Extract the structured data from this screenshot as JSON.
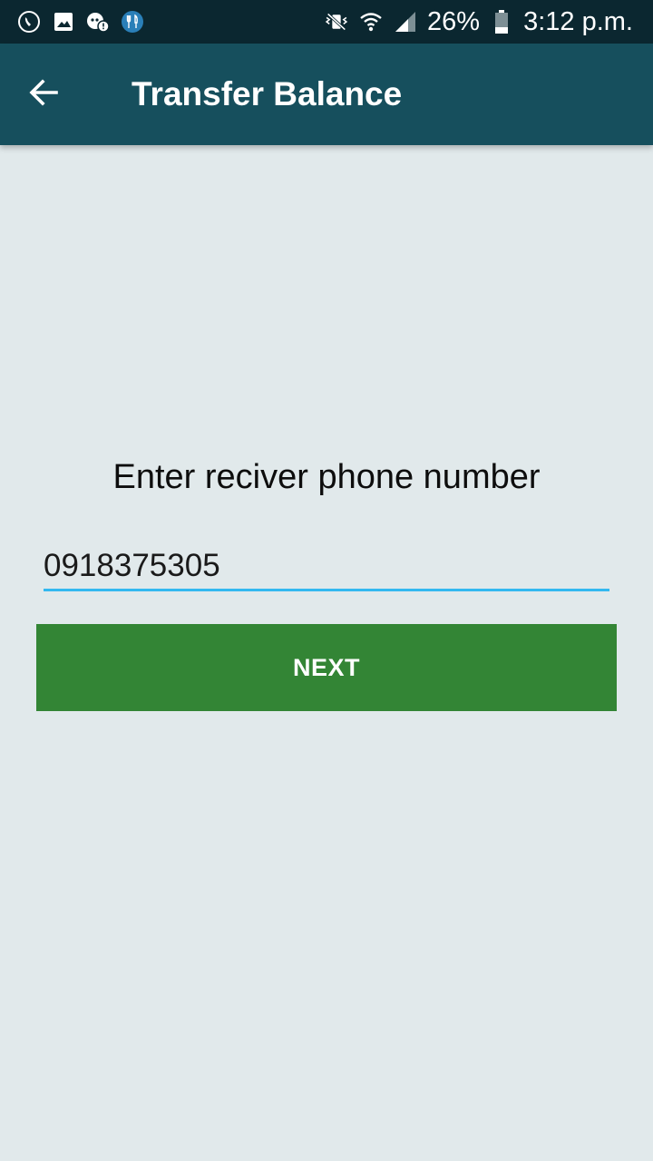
{
  "status_bar": {
    "icons_left": [
      "phone-call-icon",
      "image-icon",
      "chat-alert-icon",
      "restaurant-icon"
    ],
    "icons_right": [
      "vibrate-mute-icon",
      "wifi-icon",
      "cell-signal-icon",
      "battery-icon"
    ],
    "battery_percent": "26%",
    "time": "3:12 p.m."
  },
  "toolbar": {
    "back_icon": "arrow-left-icon",
    "title": "Transfer Balance"
  },
  "form": {
    "prompt": "Enter reciver phone number",
    "phone_value": "0918375305",
    "next_label": "NEXT"
  },
  "colors": {
    "status_bar": "#0b2730",
    "toolbar": "#164f5d",
    "background": "#e1e9eb",
    "input_underline": "#33b8f0",
    "next_button": "#338535"
  }
}
